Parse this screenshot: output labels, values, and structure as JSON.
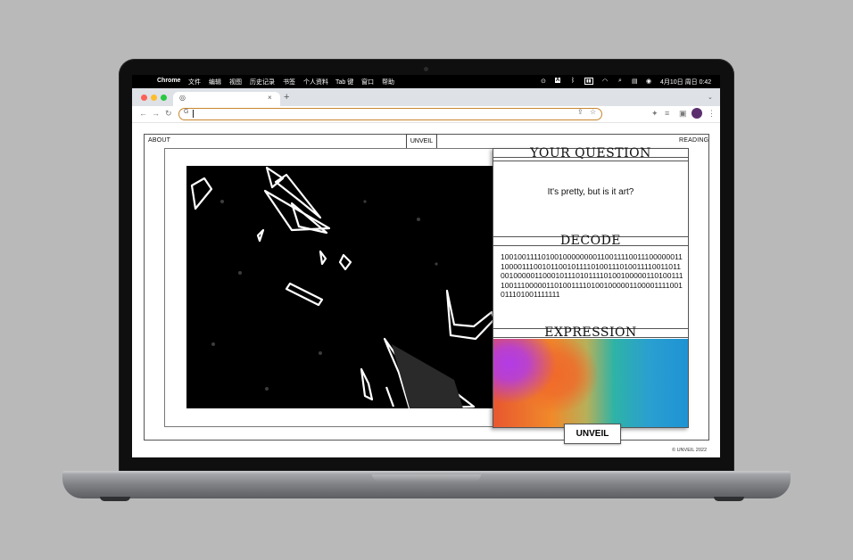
{
  "menubar": {
    "app": "Chrome",
    "items": [
      "文件",
      "编辑",
      "视图",
      "历史记录",
      "书签",
      "个人资料",
      "Tab 键",
      "窗口",
      "帮助"
    ],
    "datetime": "4月10日 周日 0:42"
  },
  "browser": {
    "omnibox_value": ""
  },
  "site": {
    "nav": {
      "about": "ABOUT",
      "unveil": "UNVEIL",
      "reading": "READING"
    },
    "question_title": "YOUR QUESTION",
    "question_text": "It's pretty, but is it art?",
    "decode_title": "DECODE",
    "binary": "100100111101001000000001100111100111000000111000011100101100101111010011101001111001101100100000110001011101011110100100000110100111100111000001101001111010010000011000011110010111010011111l1",
    "expression_title": "EXPRESSION",
    "unveil_button": "UNVEIL",
    "copyright": "© UNVEIL 2022"
  },
  "colors": {
    "omnibox_border": "#c8862e",
    "gradient": [
      "#b23be6",
      "#f06a2a",
      "#2eb3a6",
      "#1e93d4"
    ]
  }
}
